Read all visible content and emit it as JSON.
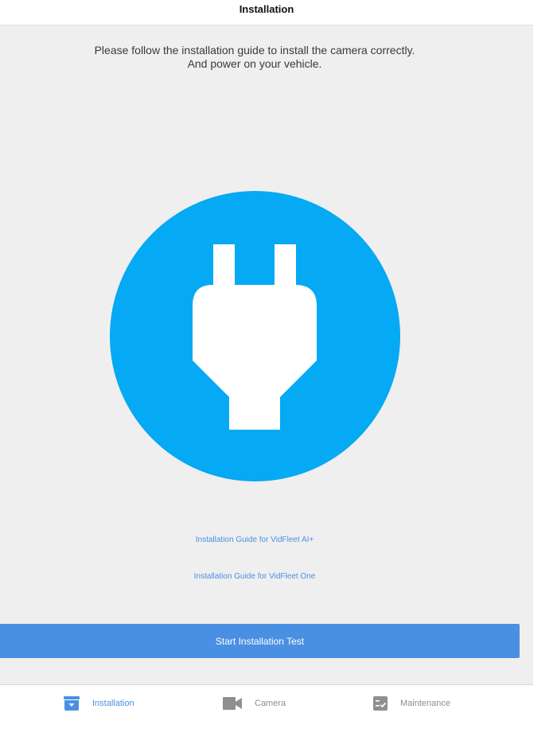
{
  "nav": {
    "title": "Installation"
  },
  "instructions": {
    "line1": "Please follow the installation guide to install the camera correctly.",
    "line2": "And power on your vehicle."
  },
  "illustration": {
    "icon": "power-plug-icon",
    "circle_color": "#05a9f4"
  },
  "links": {
    "guide_ai_plus": "Installation Guide for VidFleet AI+",
    "guide_one": "Installation Guide for VidFleet One"
  },
  "start_button": {
    "label": "Start Installation Test",
    "color": "#4a90e2"
  },
  "tabs": [
    {
      "label": "Installation",
      "icon": "installation-box-icon",
      "active": true
    },
    {
      "label": "Camera",
      "icon": "video-camera-icon",
      "active": false
    },
    {
      "label": "Maintenance",
      "icon": "checklist-icon",
      "active": false
    }
  ],
  "colors": {
    "accent": "#4a90e2",
    "background": "#efefef",
    "inactive_tab": "#8e8e93"
  }
}
